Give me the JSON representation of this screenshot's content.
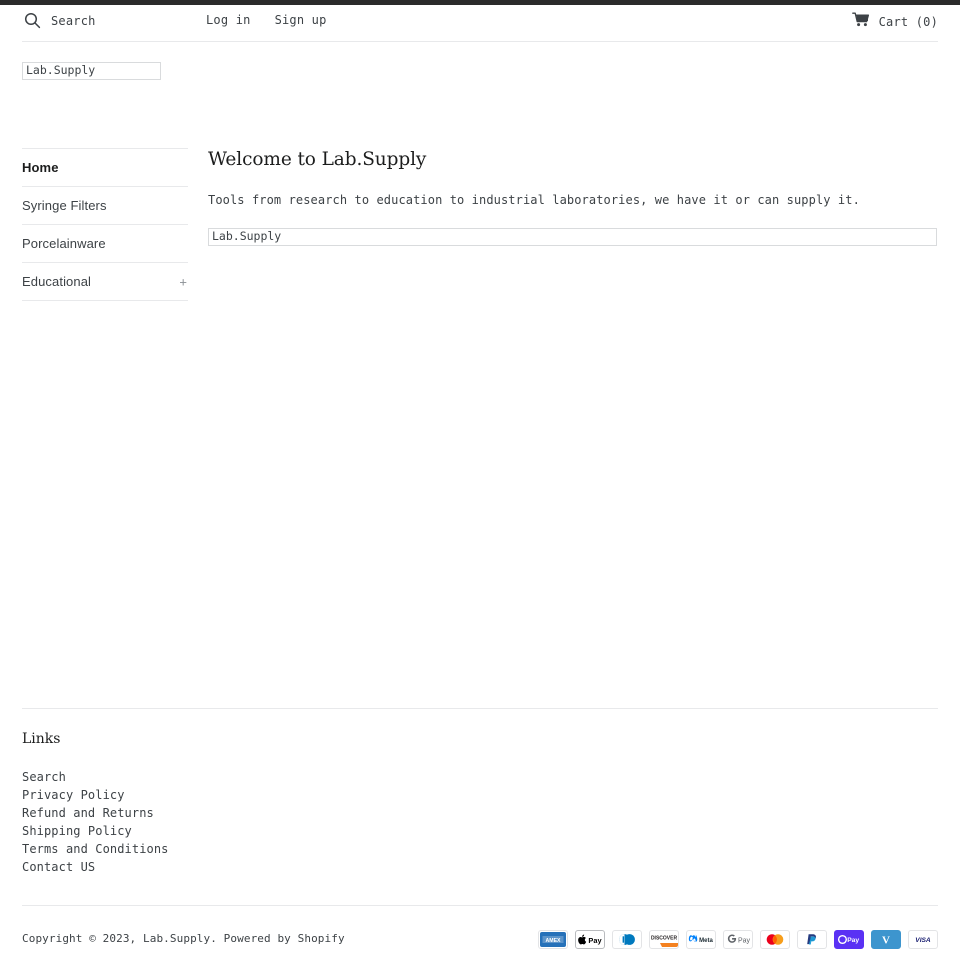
{
  "header": {
    "search": {
      "label": "Search",
      "icon": "search-icon"
    },
    "auth": [
      {
        "label": "Log in"
      },
      {
        "label": "Sign up"
      }
    ],
    "cart": {
      "label": "Cart (0)",
      "count": 0,
      "icon": "shopping-cart-icon"
    }
  },
  "branding": {
    "logo_text": "Lab.Supply"
  },
  "sidebar": {
    "items": [
      {
        "label": "Home",
        "active": true,
        "expander": ""
      },
      {
        "label": "Syringe Filters",
        "active": false,
        "expander": ""
      },
      {
        "label": "Porcelainware",
        "active": false,
        "expander": ""
      },
      {
        "label": "Educational",
        "active": false,
        "expander": "+"
      }
    ]
  },
  "main": {
    "title": "Welcome to Lab.Supply",
    "paragraph": "Tools from research to education to industrial laboratories, we have it or can supply it.",
    "content_box_text": "Lab.Supply"
  },
  "footer": {
    "heading": "Links",
    "links": [
      {
        "label": "Search"
      },
      {
        "label": "Privacy Policy"
      },
      {
        "label": "Refund and Returns"
      },
      {
        "label": "Shipping Policy"
      },
      {
        "label": "Terms and Conditions"
      },
      {
        "label": "Contact US"
      }
    ],
    "copyright": "Copyright © 2023, Lab.Supply. Powered by Shopify",
    "payments": [
      {
        "name": "american-express",
        "label": "AMEX"
      },
      {
        "name": "apple-pay",
        "label": "Pay"
      },
      {
        "name": "diners-club",
        "label": ""
      },
      {
        "name": "discover",
        "label": "DISCOVER"
      },
      {
        "name": "meta-pay",
        "label": "Meta"
      },
      {
        "name": "google-pay",
        "label": "G Pay"
      },
      {
        "name": "mastercard",
        "label": ""
      },
      {
        "name": "paypal",
        "label": ""
      },
      {
        "name": "shop-pay",
        "label": "Pay"
      },
      {
        "name": "venmo",
        "label": "V"
      },
      {
        "name": "visa",
        "label": "VISA"
      }
    ]
  },
  "colors": {
    "top_strip": "#2b2b2b",
    "text": "#3d4246",
    "rule": "#e8e9eb",
    "shop_pay": "#5a31f4",
    "venmo": "#3d95ce",
    "amex": "#2671b9",
    "paypal": "#253b80"
  }
}
